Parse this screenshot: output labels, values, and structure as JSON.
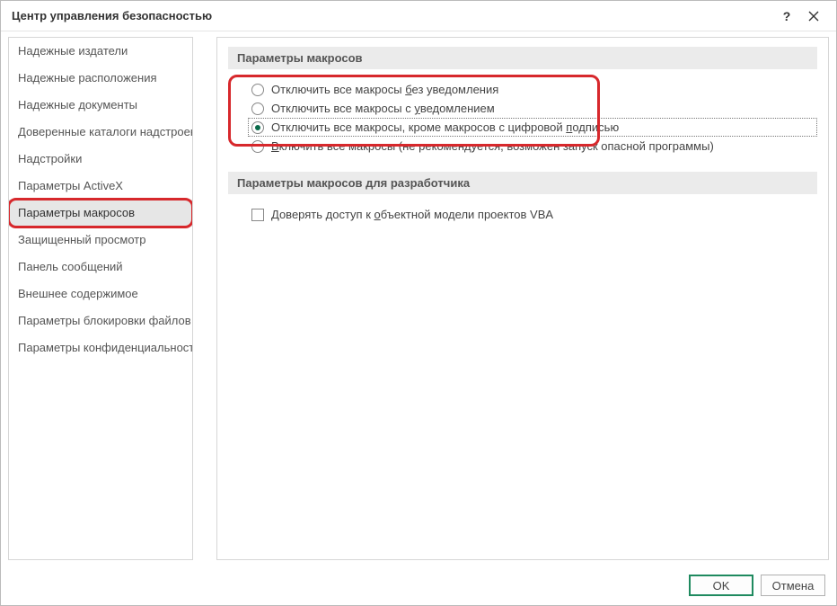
{
  "window": {
    "title": "Центр управления безопасностью"
  },
  "sidebar": {
    "items": [
      "Надежные издатели",
      "Надежные расположения",
      "Надежные документы",
      "Доверенные каталоги надстроек",
      "Надстройки",
      "Параметры ActiveX",
      "Параметры макросов",
      "Защищенный просмотр",
      "Панель сообщений",
      "Внешнее содержимое",
      "Параметры блокировки файлов",
      "Параметры конфиденциальности"
    ],
    "selected_index": 6
  },
  "content": {
    "group1_title": "Параметры макросов",
    "macro_options": [
      {
        "pre": "Отключить все макросы ",
        "u": "б",
        "post": "ез уведомления",
        "checked": false
      },
      {
        "pre": "Отключить все макросы с ",
        "u": "у",
        "post": "ведомлением",
        "checked": false
      },
      {
        "pre": "Отключить все макросы, кроме макросов с цифровой ",
        "u": "п",
        "post": "одписью",
        "checked": true
      },
      {
        "pre": "",
        "u": "В",
        "post": "ключить все макросы (не рекомендуется, возможен запуск опасной программы)",
        "checked": false
      }
    ],
    "group2_title": "Параметры макросов для разработчика",
    "dev_option": {
      "pre": "Доверять доступ к ",
      "u": "о",
      "post": "бъектной модели проектов VBA",
      "checked": false
    }
  },
  "footer": {
    "ok": "OK",
    "cancel": "Отмена"
  }
}
